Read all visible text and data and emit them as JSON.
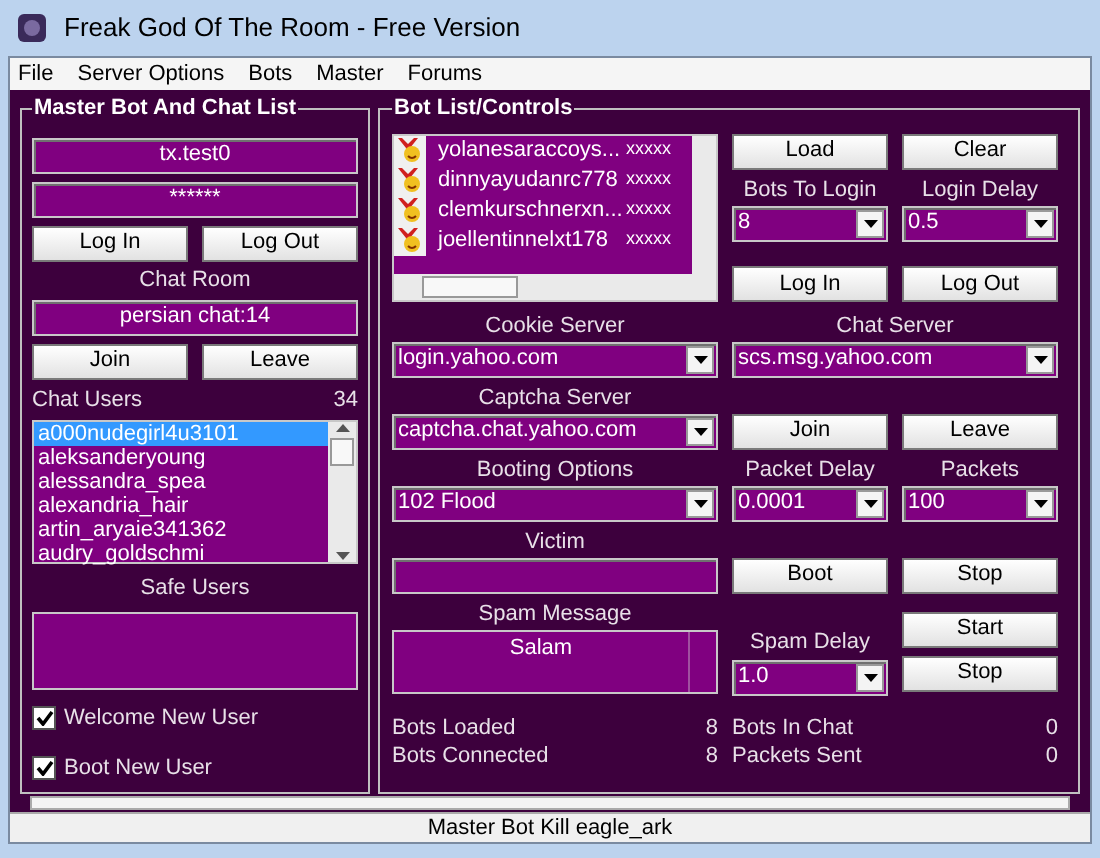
{
  "window": {
    "title": "Freak God Of The Room - Free Version"
  },
  "menu": [
    "File",
    "Server Options",
    "Bots",
    "Master",
    "Forums"
  ],
  "master_panel": {
    "title": "Master Bot And Chat List",
    "username": "tx.test0",
    "password": "******",
    "login_buttons": [
      "Log In",
      "Log Out"
    ],
    "chat_room_label": "Chat Room",
    "chat_room": "persian chat:14",
    "room_buttons": [
      "Join",
      "Leave"
    ],
    "chat_users_label": "Chat Users",
    "chat_users_count": "34",
    "chat_users": [
      {
        "name": "a000nudegirl4u3101",
        "selected": true
      },
      {
        "name": "aleksanderyoung",
        "selected": false
      },
      {
        "name": "alessandra_spea",
        "selected": false
      },
      {
        "name": "alexandria_hair",
        "selected": false
      },
      {
        "name": "artin_aryaie341362",
        "selected": false
      },
      {
        "name": "audry_goldschmi",
        "selected": false
      }
    ],
    "safe_users_label": "Safe Users",
    "options": [
      {
        "label": "Welcome New User",
        "checked": true
      },
      {
        "label": "Boot New User",
        "checked": true
      }
    ]
  },
  "bot_panel": {
    "title": "Bot List/Controls",
    "bots": [
      {
        "name": "yolanesaraccoys...",
        "password": "xxxxx"
      },
      {
        "name": "dinnyayudanrc778",
        "password": "xxxxx"
      },
      {
        "name": "clemkurschnerxn...",
        "password": "xxxxx"
      },
      {
        "name": "joellentinnelxt178",
        "password": "xxxxx"
      }
    ],
    "load_button": "Load",
    "clear_button": "Clear",
    "bots_to_login": {
      "label": "Bots To Login",
      "value": "8"
    },
    "login_delay": {
      "label": "Login Delay",
      "value": "0.5"
    },
    "login_buttons": [
      "Log In",
      "Log Out"
    ],
    "cookie_server": {
      "label": "Cookie Server",
      "value": "login.yahoo.com"
    },
    "chat_server": {
      "label": "Chat Server",
      "value": "scs.msg.yahoo.com"
    },
    "captcha_server": {
      "label": "Captcha Server",
      "value": "captcha.chat.yahoo.com"
    },
    "room_buttons": [
      "Join",
      "Leave"
    ],
    "booting_options": {
      "label": "Booting Options",
      "value": "102 Flood"
    },
    "packet_delay": {
      "label": "Packet Delay",
      "value": "0.0001"
    },
    "packets": {
      "label": "Packets",
      "value": "100"
    },
    "victim_label": "Victim",
    "boot_buttons": [
      "Boot",
      "Stop"
    ],
    "spam_message": {
      "label": "Spam Message",
      "value": "Salam"
    },
    "spam_delay": {
      "label": "Spam Delay",
      "value": "1.0"
    },
    "spam_buttons": [
      "Start",
      "Stop"
    ],
    "stats": [
      {
        "label": "Bots Loaded",
        "value": "8"
      },
      {
        "label": "Bots In Chat",
        "value": "0"
      },
      {
        "label": "Bots Connected",
        "value": "8"
      },
      {
        "label": "Packets Sent",
        "value": "0"
      }
    ]
  },
  "progress": {
    "level": 0
  },
  "status_bar": "Master Bot Kill eagle_ark"
}
